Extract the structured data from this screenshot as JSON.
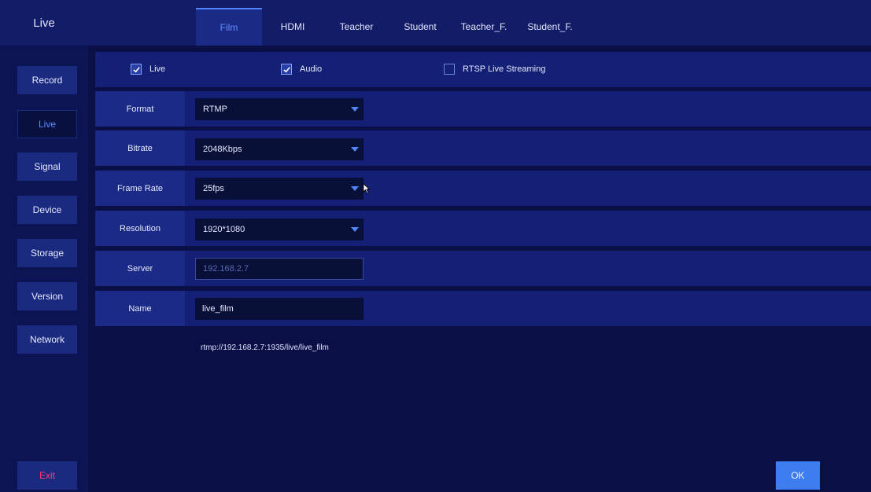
{
  "app_title": "Live",
  "tabs": [
    {
      "label": "Film",
      "active": true
    },
    {
      "label": "HDMI",
      "active": false
    },
    {
      "label": "Teacher",
      "active": false
    },
    {
      "label": "Student",
      "active": false
    },
    {
      "label": "Teacher_F.",
      "active": false
    },
    {
      "label": "Student_F.",
      "active": false
    }
  ],
  "sidebar": {
    "items": [
      {
        "label": "Record",
        "active": false
      },
      {
        "label": "Live",
        "active": true
      },
      {
        "label": "Signal",
        "active": false
      },
      {
        "label": "Device",
        "active": false
      },
      {
        "label": "Storage",
        "active": false
      },
      {
        "label": "Version",
        "active": false
      },
      {
        "label": "Network",
        "active": false
      }
    ],
    "exit_label": "Exit"
  },
  "toggles": [
    {
      "label": "Live",
      "checked": true
    },
    {
      "label": "Audio",
      "checked": true
    },
    {
      "label": "RTSP Live Streaming",
      "checked": false
    }
  ],
  "fields": {
    "format": {
      "label": "Format",
      "value": "RTMP"
    },
    "bitrate": {
      "label": "Bitrate",
      "value": "2048Kbps"
    },
    "frame_rate": {
      "label": "Frame Rate",
      "value": "25fps"
    },
    "resolution": {
      "label": "Resolution",
      "value": "1920*1080"
    },
    "server": {
      "label": "Server",
      "value": "192.168.2.7"
    },
    "name": {
      "label": "Name",
      "value": "live_film"
    }
  },
  "stream_url": "rtmp://192.168.2.7:1935/live/live_film",
  "ok_label": "OK",
  "colors": {
    "accent": "#4f86ff",
    "exit": "#ff3c78",
    "background": "#0a1046"
  }
}
